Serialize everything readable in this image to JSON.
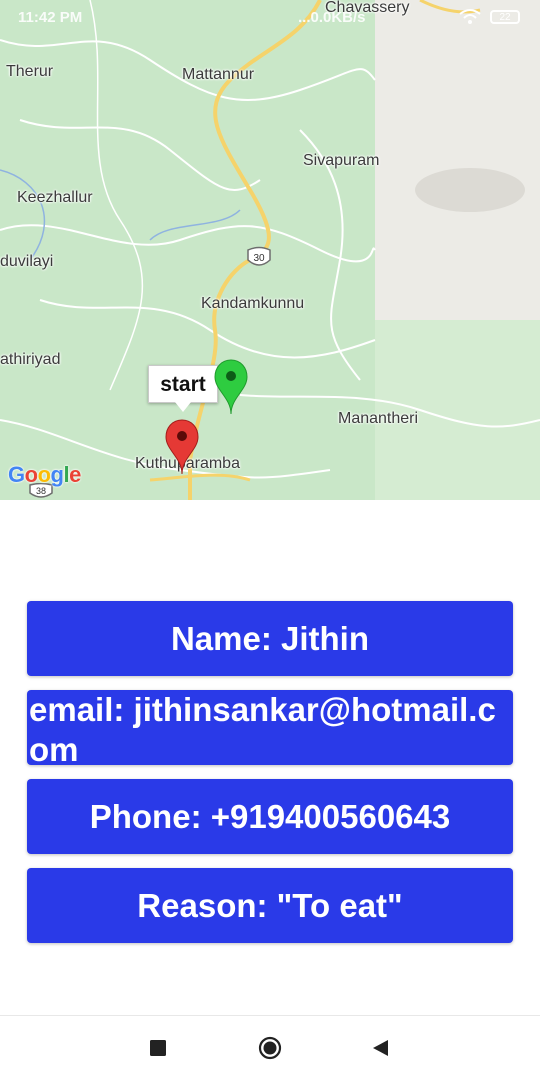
{
  "status_bar": {
    "time": "11:42 PM",
    "network_speed": "...0.0KB/s",
    "battery": "22"
  },
  "map": {
    "places": [
      {
        "name": "Chavassery"
      },
      {
        "name": "Therur"
      },
      {
        "name": "Mattannur"
      },
      {
        "name": "Sivapuram"
      },
      {
        "name": "Keezhallur"
      },
      {
        "name": "duvilayi"
      },
      {
        "name": "Kandamkunnu"
      },
      {
        "name": "athiriyad"
      },
      {
        "name": "Manantheri"
      },
      {
        "name": "Kuthuparamba"
      }
    ],
    "highway_shield": "30",
    "highway_shield_2": "38",
    "marker_label": "start",
    "logo": "Google",
    "colors": {
      "start_marker": "#e53935",
      "end_marker": "#2ecc40",
      "road": "#f5d36b"
    }
  },
  "details": {
    "name": "Name: Jithin",
    "email": "email: jithinsankar@hotmail.com",
    "phone": "Phone: +919400560643",
    "reason": "Reason: \"To eat\"",
    "button_color": "#2a3ae8"
  },
  "navigation": {
    "icons": [
      "square-recents-icon",
      "circle-home-icon",
      "triangle-back-icon"
    ]
  }
}
